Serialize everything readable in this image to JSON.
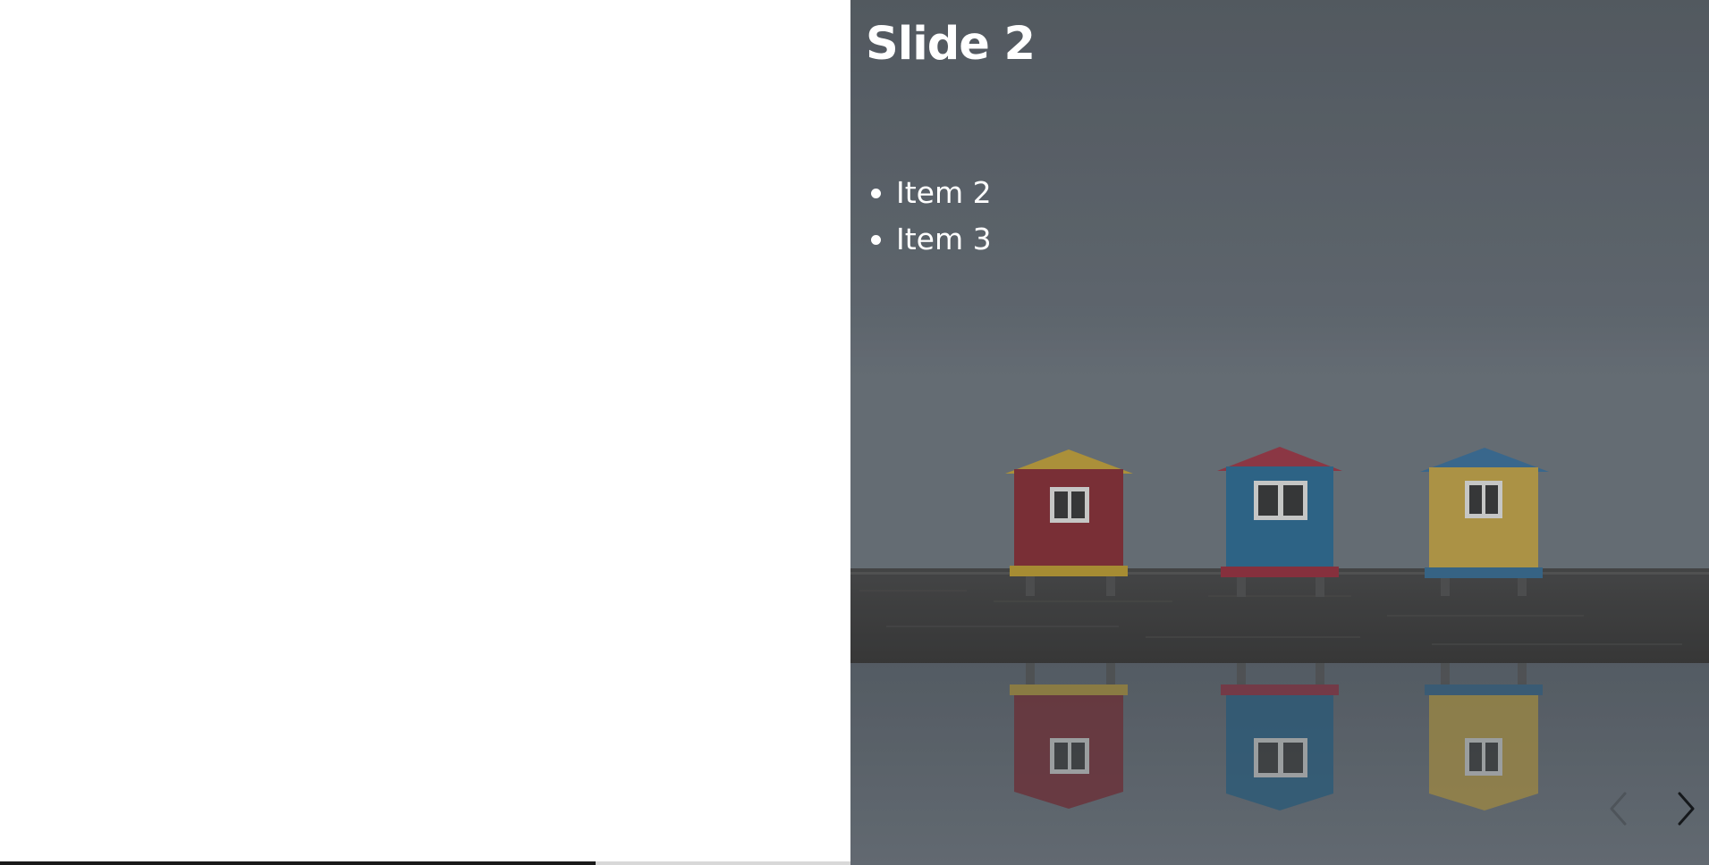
{
  "slide": {
    "title": "Slide 2",
    "items": [
      "Item 2",
      "Item 3"
    ]
  },
  "navigation": {
    "prev_icon": "chevron-left-icon",
    "next_icon": "chevron-right-icon",
    "prev_enabled": false,
    "next_enabled": true
  },
  "progress": {
    "fraction": 0.7
  },
  "colors": {
    "overlay": "#5f666d",
    "text": "#ffffff",
    "progress_fill": "#1a1a1a",
    "progress_track": "#d8d8d8"
  }
}
